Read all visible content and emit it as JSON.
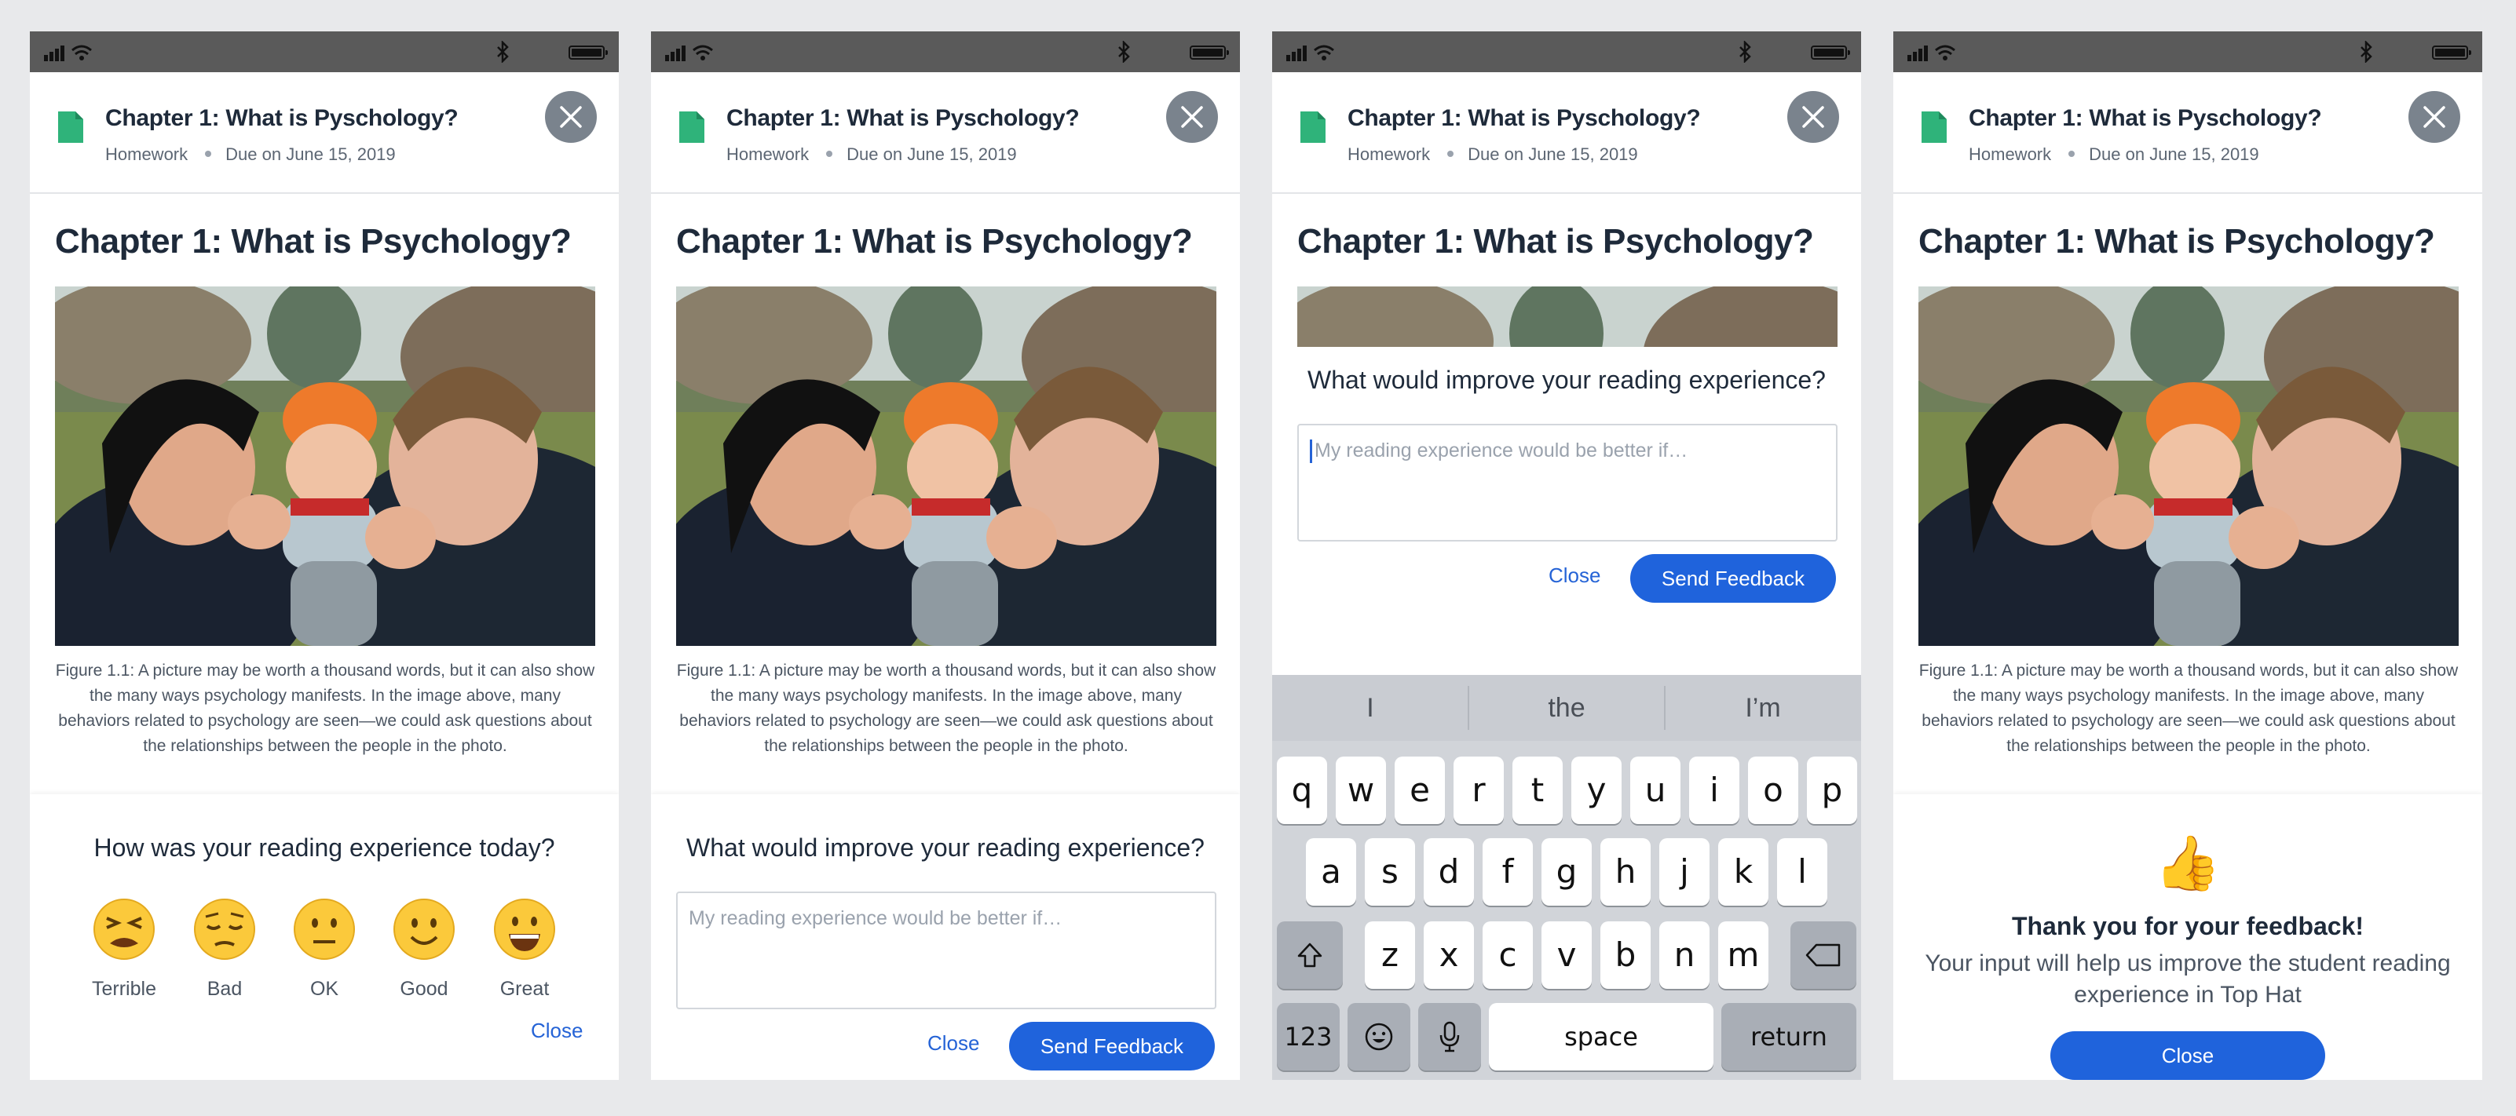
{
  "header": {
    "title": "Chapter 1: What is Pyschology?",
    "type": "Homework",
    "due": "Due on June 15, 2019"
  },
  "content": {
    "chapter_title": "Chapter 1: What is Psychology?",
    "caption": "Figure 1.1: A picture may be worth a thousand words, but it can also show the many ways psychology manifests. In the image above, many behaviors related to psychology are seen—we could ask questions about the relationships between the people in the photo."
  },
  "rating_panel": {
    "question": "How was your reading experience today?",
    "options": [
      {
        "label": "Terrible",
        "icon": "tired-face-emoji"
      },
      {
        "label": "Bad",
        "icon": "pensive-face-emoji"
      },
      {
        "label": "OK",
        "icon": "neutral-face-emoji"
      },
      {
        "label": "Good",
        "icon": "smiling-face-emoji"
      },
      {
        "label": "Great",
        "icon": "grinning-face-emoji"
      }
    ],
    "close_label": "Close"
  },
  "feedback_panel": {
    "question": "What would improve your reading experience?",
    "placeholder": "My reading experience would be better if…",
    "close_label": "Close",
    "send_label": "Send Feedback"
  },
  "keyboard": {
    "suggestions": [
      "I",
      "the",
      "I’m"
    ],
    "row1": [
      "q",
      "w",
      "e",
      "r",
      "t",
      "y",
      "u",
      "i",
      "o",
      "p"
    ],
    "row2": [
      "a",
      "s",
      "d",
      "f",
      "g",
      "h",
      "j",
      "k",
      "l"
    ],
    "row3": [
      "z",
      "x",
      "c",
      "v",
      "b",
      "n",
      "m"
    ],
    "numbers_label": "123",
    "space_label": "space",
    "return_label": "return"
  },
  "thanks_panel": {
    "icon": "thumbs-up-emoji",
    "emoji": "👍",
    "title": "Thank you for your feedback!",
    "message": "Your input will help us improve the student reading experience in Top Hat",
    "close_label": "Close"
  },
  "colors": {
    "accent": "#1f63dc",
    "doc_icon": "#2fb37a",
    "status_bar": "#5a5a5a",
    "title_text": "#1e2a3a"
  }
}
